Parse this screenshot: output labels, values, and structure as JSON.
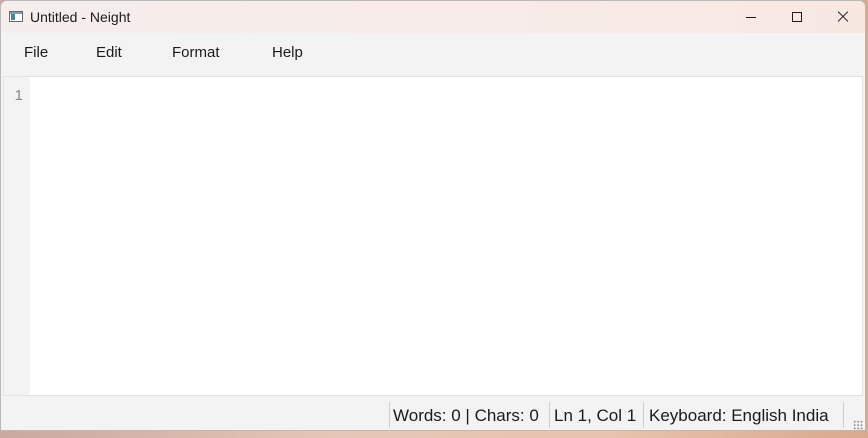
{
  "window": {
    "title": "Untitled - Neight"
  },
  "icons": {
    "app": "app-icon",
    "minimize": "minimize-icon",
    "maximize": "maximize-icon",
    "close": "close-icon",
    "grip": "resize-grip-icon"
  },
  "menu": {
    "file": "File",
    "edit": "Edit",
    "format": "Format",
    "help": "Help"
  },
  "editor": {
    "line_number": "1",
    "content": ""
  },
  "status": {
    "words_chars": "Words: 0 | Chars: 0",
    "position": "Ln 1, Col 1",
    "keyboard": "Keyboard: English India"
  },
  "colors": {
    "chrome": "#f3f3f3",
    "editor_bg": "#ffffff",
    "gutter_text": "#8a8a8a"
  }
}
